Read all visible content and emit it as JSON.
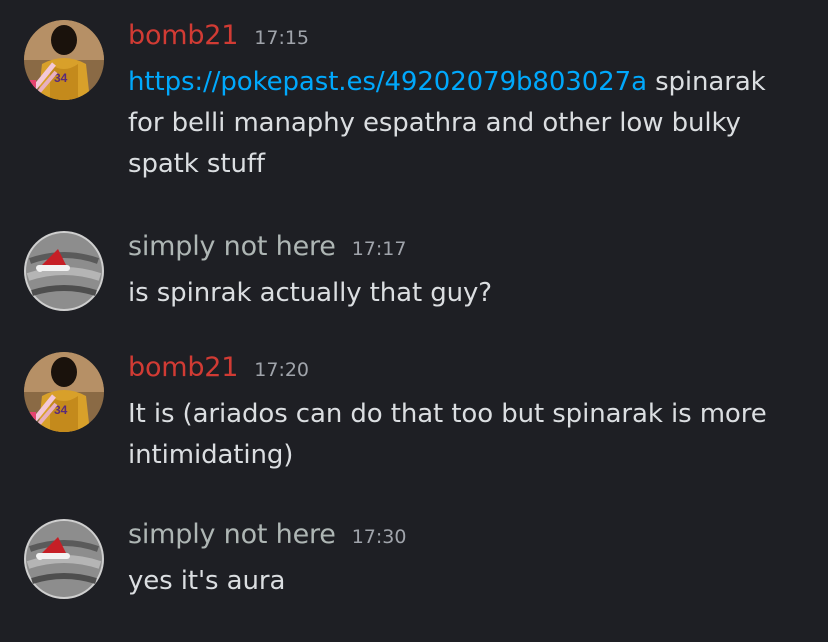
{
  "colors": {
    "background": "#1e1f24",
    "text": "#dbdee1",
    "link": "#00a8fc",
    "username_bomb21": "#d13b34",
    "username_simply": "#aeb6b4",
    "timestamp": "#a0a4ab"
  },
  "messages": [
    {
      "username": "bomb21",
      "timestamp": "17:15",
      "avatar_icon": "avatar-basketball-player",
      "link": "https://pokepast.es/49202079b803027a",
      "text": " spinarak for belli manaphy espathra and other low bulky spatk stuff"
    },
    {
      "username": "simply not here",
      "timestamp": "17:17",
      "avatar_icon": "avatar-santa-hat-gray",
      "text": "is spinrak actually that guy?"
    },
    {
      "username": "bomb21",
      "timestamp": "17:20",
      "avatar_icon": "avatar-basketball-player",
      "text": "It is (ariados can do that too but spinarak is more intimidating)"
    },
    {
      "username": "simply not here",
      "timestamp": "17:30",
      "avatar_icon": "avatar-santa-hat-gray",
      "text": "yes it's aura"
    }
  ]
}
